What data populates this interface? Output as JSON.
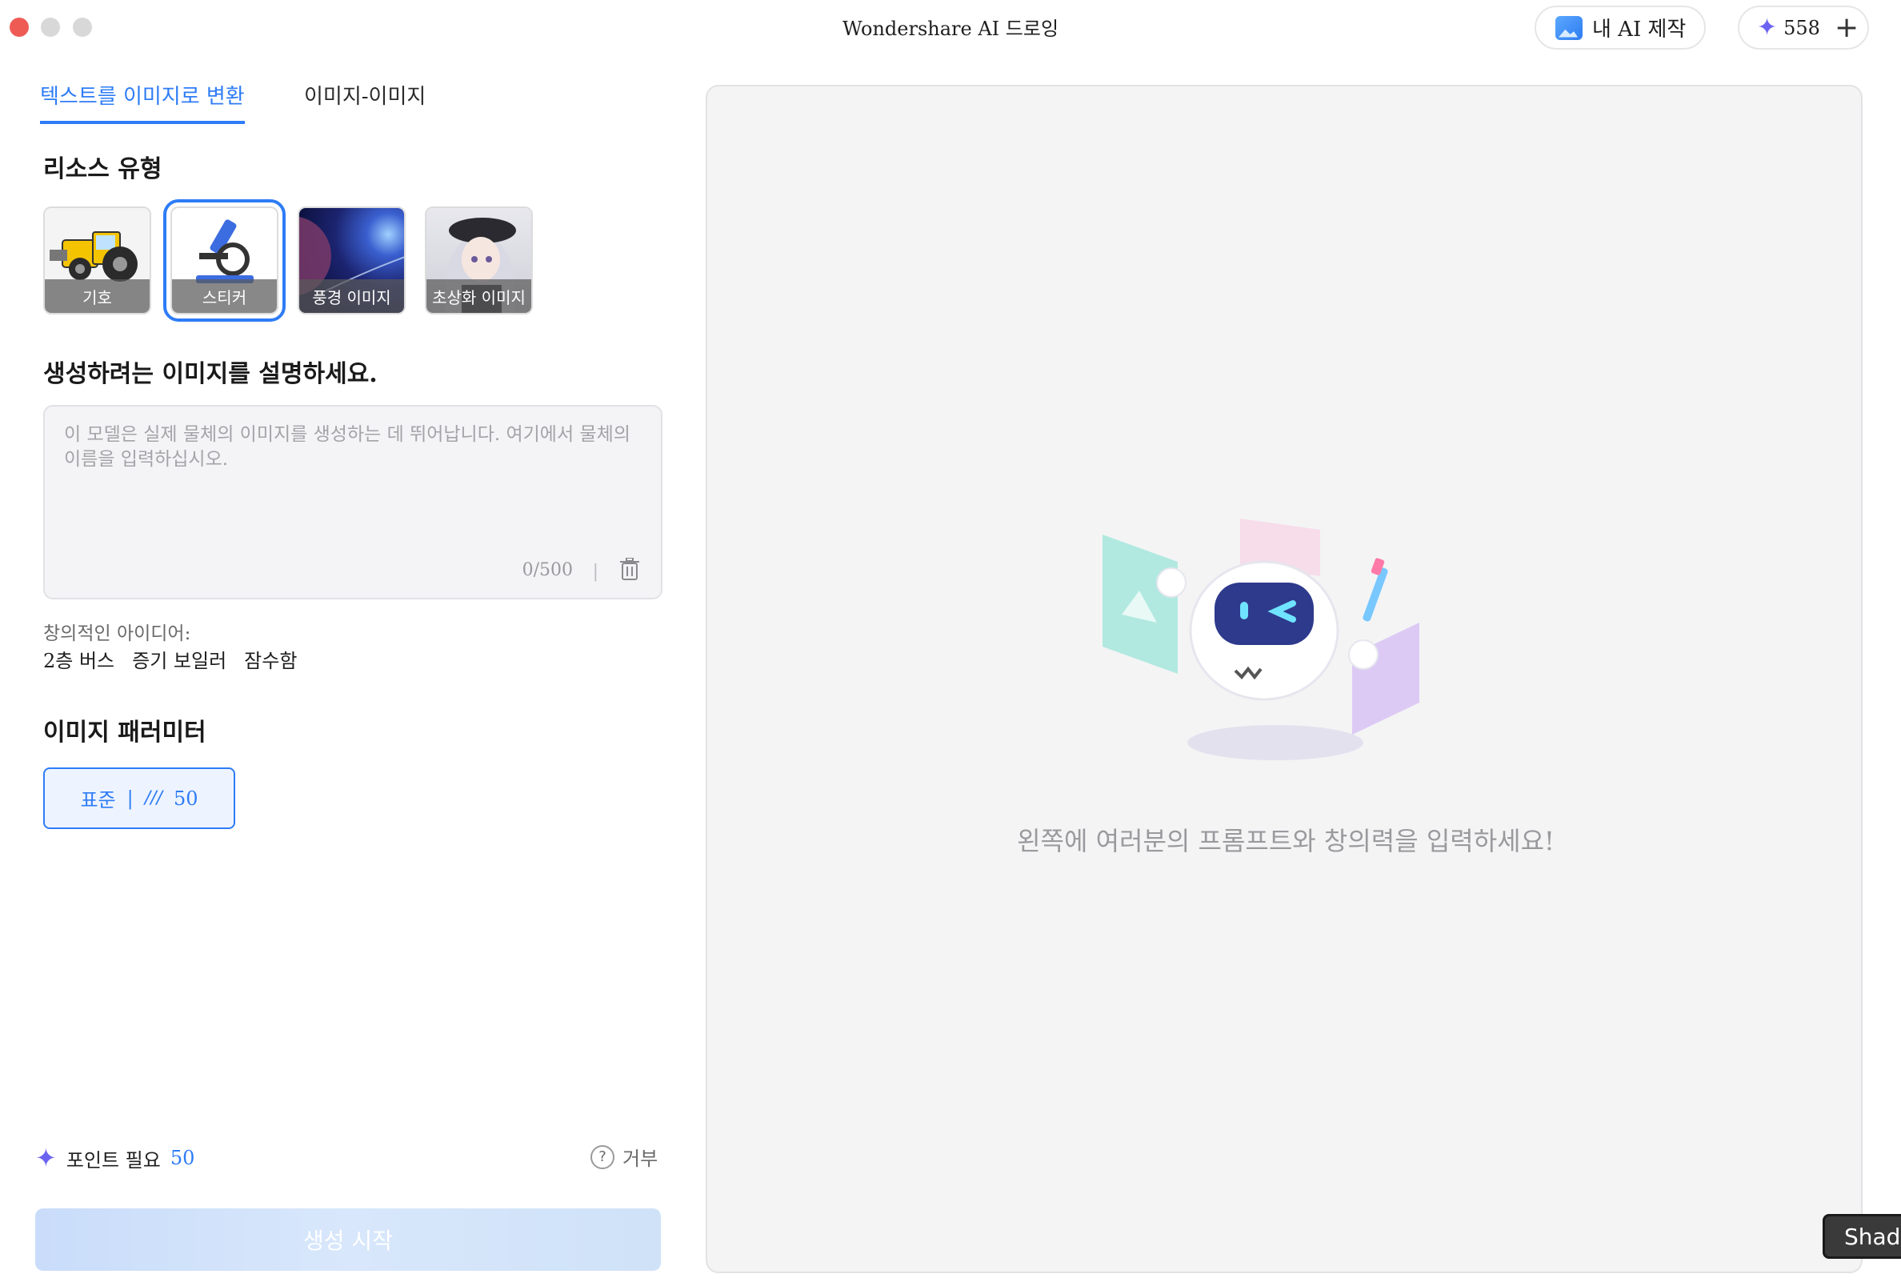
{
  "app": {
    "title": "Wondershare AI 드로잉",
    "my_creations_label": "내 AI 제작",
    "credits": "558"
  },
  "tabs": [
    {
      "label": "텍스트를 이미지로 변환",
      "active": true
    },
    {
      "label": "이미지-이미지",
      "active": false
    }
  ],
  "resource_section": {
    "title": "리소스 유형",
    "items": [
      {
        "label": "기호",
        "selected": false
      },
      {
        "label": "스티커",
        "selected": true
      },
      {
        "label": "풍경 이미지",
        "selected": false
      },
      {
        "label": "초상화 이미지",
        "selected": false
      }
    ]
  },
  "prompt": {
    "title": "생성하려는 이미지를 설명하세요.",
    "placeholder": "이 모델은 실제 물체의 이미지를 생성하는 데 뛰어납니다. 여기에서 물체의 이름을 입력하십시오.",
    "count": "0/500",
    "separator": "|"
  },
  "ideas": {
    "label": "창의적인 아이디어:",
    "items": [
      "2층 버스",
      "증기 보일러",
      "잠수함"
    ]
  },
  "parameters": {
    "title": "이미지 패러미터",
    "option_label": "표준",
    "separator": "|",
    "cost": "50"
  },
  "footer": {
    "points_label": "포인트 필요",
    "points_value": "50",
    "refuse_label": "거부",
    "generate_label": "생성 시작"
  },
  "preview": {
    "message": "왼쪽에 여러분의 프롬프트와 창의력을 입력하세요!"
  },
  "overlay": {
    "shade_label": "Shade"
  },
  "colors": {
    "accent": "#2e7cf6",
    "sparkle": "#6b63f0"
  }
}
